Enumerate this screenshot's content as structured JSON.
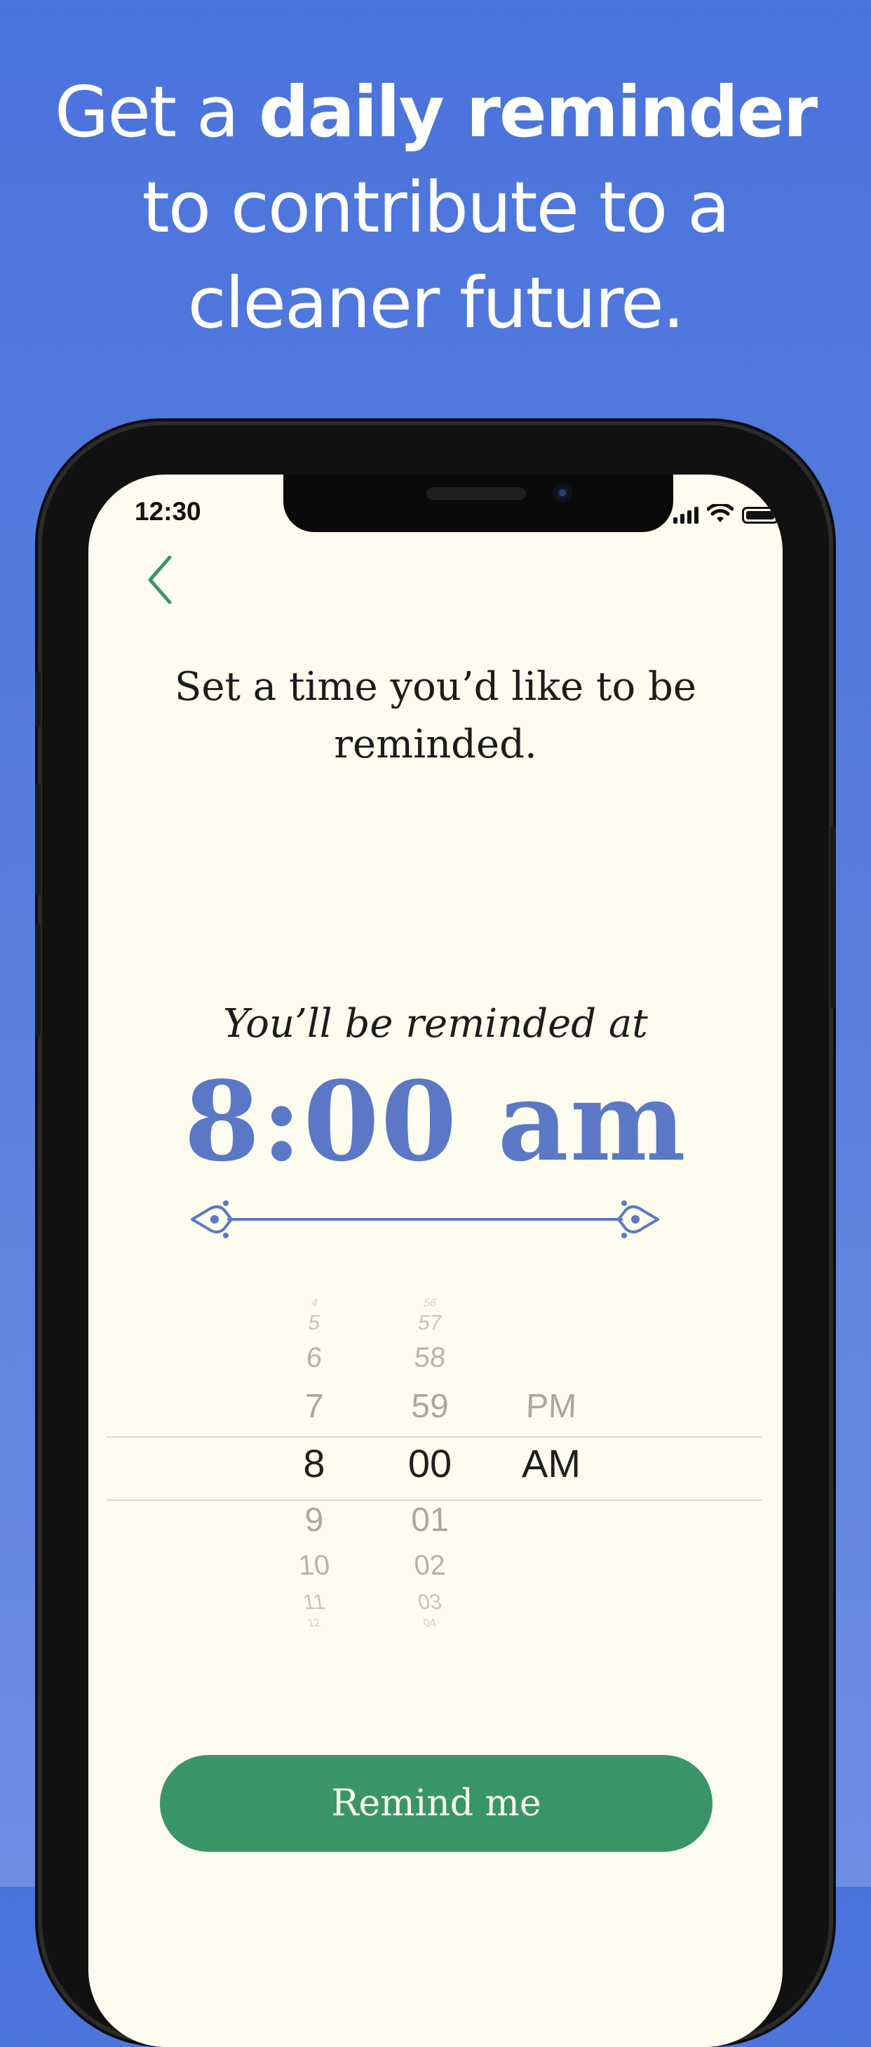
{
  "marketing": {
    "headline_pre": "Get a ",
    "headline_bold": "daily reminder",
    "headline_line2": "to contribute to a",
    "headline_line3": "cleaner future."
  },
  "status_bar": {
    "time": "12:30",
    "icons": [
      "cellular-signal-icon",
      "wifi-icon",
      "battery-icon"
    ]
  },
  "nav": {
    "back_icon": "chevron-left-icon"
  },
  "content": {
    "prompt": "Set a time you’d like to be reminded.",
    "subprompt": "You’ll be reminded at",
    "selected_time_display": "8:00 am"
  },
  "picker": {
    "hours": [
      "4",
      "5",
      "6",
      "7",
      "8",
      "9",
      "10",
      "11",
      "12"
    ],
    "minutes": [
      "56",
      "57",
      "58",
      "59",
      "00",
      "01",
      "02",
      "03",
      "04"
    ],
    "periods": [
      "PM",
      "AM"
    ],
    "selected": {
      "hour": "8",
      "minute": "00",
      "period": "AM"
    }
  },
  "actions": {
    "remind_label": "Remind me"
  },
  "colors": {
    "background": "#4a73dc",
    "screen_bg": "#fdfcef",
    "accent_blue": "#5b78c7",
    "button_green": "#3a9566",
    "back_green": "#3a9566"
  }
}
